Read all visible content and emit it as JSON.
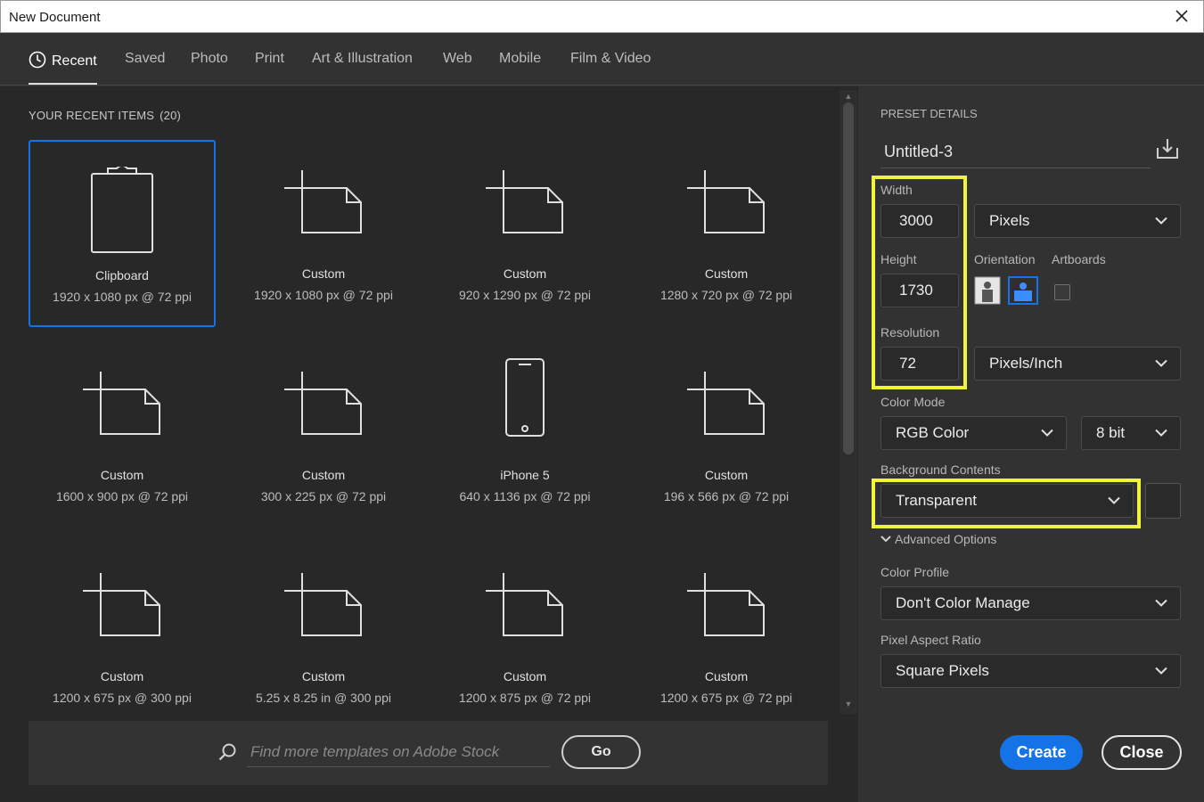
{
  "window": {
    "title": "New Document"
  },
  "tabs": [
    {
      "label": "Recent"
    },
    {
      "label": "Saved"
    },
    {
      "label": "Photo"
    },
    {
      "label": "Print"
    },
    {
      "label": "Art & Illustration"
    },
    {
      "label": "Web"
    },
    {
      "label": "Mobile"
    },
    {
      "label": "Film & Video"
    }
  ],
  "recent": {
    "header": "YOUR RECENT ITEMS",
    "count": "(20)",
    "items": [
      {
        "name": "Clipboard",
        "dims": "1920 x 1080 px @ 72 ppi",
        "icon": "clipboard-icon",
        "selected": true
      },
      {
        "name": "Custom",
        "dims": "1920 x 1080 px @ 72 ppi",
        "icon": "custom-doc-icon"
      },
      {
        "name": "Custom",
        "dims": "920 x 1290 px @ 72 ppi",
        "icon": "custom-doc-icon"
      },
      {
        "name": "Custom",
        "dims": "1280 x 720 px @ 72 ppi",
        "icon": "custom-doc-icon"
      },
      {
        "name": "Custom",
        "dims": "1600 x 900 px @ 72 ppi",
        "icon": "custom-doc-icon"
      },
      {
        "name": "Custom",
        "dims": "300 x 225 px @ 72 ppi",
        "icon": "custom-doc-icon"
      },
      {
        "name": "iPhone 5",
        "dims": "640 x 1136 px @ 72 ppi",
        "icon": "phone-icon"
      },
      {
        "name": "Custom",
        "dims": "196 x 566 px @ 72 ppi",
        "icon": "custom-doc-icon"
      },
      {
        "name": "Custom",
        "dims": "1200 x 675 px @ 300 ppi",
        "icon": "custom-doc-icon"
      },
      {
        "name": "Custom",
        "dims": "5.25 x 8.25 in @ 300 ppi",
        "icon": "custom-doc-icon"
      },
      {
        "name": "Custom",
        "dims": "1200 x 875 px @ 72 ppi",
        "icon": "custom-doc-icon"
      },
      {
        "name": "Custom",
        "dims": "1200 x 675 px @ 72 ppi",
        "icon": "custom-doc-icon"
      }
    ]
  },
  "stock": {
    "placeholder": "Find more templates on Adobe Stock",
    "go_label": "Go"
  },
  "preset": {
    "header": "PRESET DETAILS",
    "name": "Untitled-3",
    "width_label": "Width",
    "width": "3000",
    "units": "Pixels",
    "height_label": "Height",
    "height": "1730",
    "orientation_label": "Orientation",
    "artboards_label": "Artboards",
    "resolution_label": "Resolution",
    "resolution": "72",
    "resolution_units": "Pixels/Inch",
    "color_mode_label": "Color Mode",
    "color_mode": "RGB Color",
    "bit_depth": "8 bit",
    "background_label": "Background Contents",
    "background": "Transparent",
    "advanced_label": "Advanced Options",
    "color_profile_label": "Color Profile",
    "color_profile": "Don't Color Manage",
    "pixel_aspect_label": "Pixel Aspect Ratio",
    "pixel_aspect": "Square Pixels",
    "create_label": "Create",
    "close_label": "Close"
  },
  "colors": {
    "accent": "#1473e6",
    "highlight": "#f0f53c",
    "panel": "#323232",
    "grid_bg": "#282828"
  }
}
